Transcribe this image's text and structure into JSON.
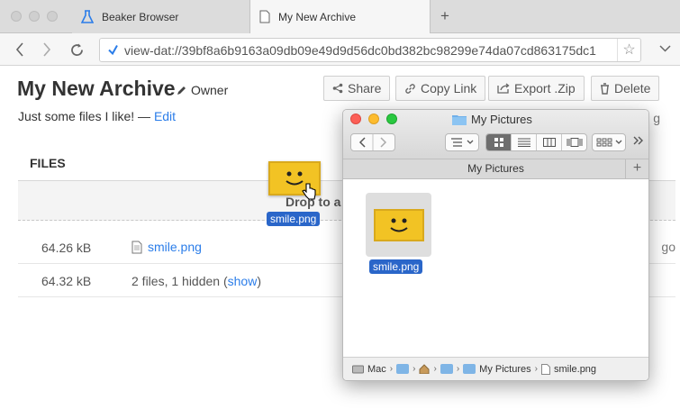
{
  "browser": {
    "tabs": [
      {
        "label": "Beaker Browser"
      },
      {
        "label": "My New Archive"
      }
    ],
    "new_tab": "+",
    "url": "view-dat://39bf8a6b9163a09db09e49d9d56dc0bd382bc98299e74da07cd863175dc1"
  },
  "archive": {
    "title": "My New Archive",
    "owner_label": "Owner",
    "description": "Just some files I like! — ",
    "edit_label": "Edit",
    "buttons": {
      "share": "Share",
      "copy_link": "Copy Link",
      "export_zip": "Export .Zip",
      "delete": "Delete"
    },
    "files_header": "FILES",
    "drop_text": "Drop to a",
    "rows": [
      {
        "size": "64.26 kB",
        "name": "smile.png",
        "right": "go"
      },
      {
        "size": "64.32 kB",
        "summary": "2 files, 1 hidden (",
        "show_label": "show",
        "summary_end": ")"
      }
    ],
    "partial_right_text": "g"
  },
  "drag": {
    "label": "smile.png"
  },
  "finder": {
    "title": "My Pictures",
    "path_tab": "My Pictures",
    "file_label": "smile.png",
    "path_bar": [
      "Mac",
      "My Pictures",
      "smile.png"
    ]
  },
  "colors": {
    "accent": "#2b7de9",
    "selection": "#2a66c9",
    "smile_bg": "#f2c324"
  }
}
